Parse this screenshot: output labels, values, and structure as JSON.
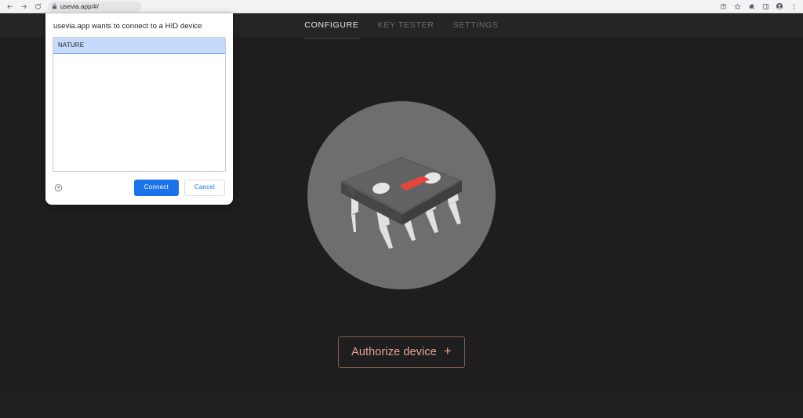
{
  "browser": {
    "back_label": "Back",
    "forward_label": "Forward",
    "reload_label": "Reload",
    "url": "usevia.app/#/",
    "lock_icon": "lock-icon",
    "toolbar_icons": [
      {
        "name": "share-icon",
        "label": "Share this page"
      },
      {
        "name": "bookmark-star-icon",
        "label": "Bookmark this tab"
      },
      {
        "name": "extensions-puzzle-icon",
        "label": "Extensions"
      },
      {
        "name": "side-panel-icon",
        "label": "Side panel"
      },
      {
        "name": "profile-avatar-icon",
        "label": "Profile"
      },
      {
        "name": "three-dot-menu-icon",
        "label": "Customize and control Chrome"
      }
    ]
  },
  "appbar": {
    "items": [
      {
        "label": "CONFIGURE",
        "active": true
      },
      {
        "label": "KEY TESTER",
        "active": false
      },
      {
        "label": "SETTINGS",
        "active": false
      }
    ]
  },
  "main": {
    "illustration": {
      "name": "ic-chip-illustration",
      "circle_color": "#6e6e6e",
      "chip_top_color": "#5e5e5e",
      "chip_body_color": "#4a4a4a",
      "pin_color": "#e4e4e4",
      "dot_color": "#e8e8e8",
      "accent_color": "#e8453c"
    },
    "authorize_button": {
      "label": "Authorize device",
      "plus_icon": "plus-icon",
      "text_color": "#e8a294",
      "border_color": "#8a5a52"
    }
  },
  "dialog": {
    "title": "usevia.app wants to connect to a HID device",
    "devices": [
      {
        "name": "NATURE",
        "selected": true
      }
    ],
    "help_icon": "help-circle-icon",
    "connect_label": "Connect",
    "cancel_label": "Cancel",
    "primary_color": "#1a73e8"
  }
}
